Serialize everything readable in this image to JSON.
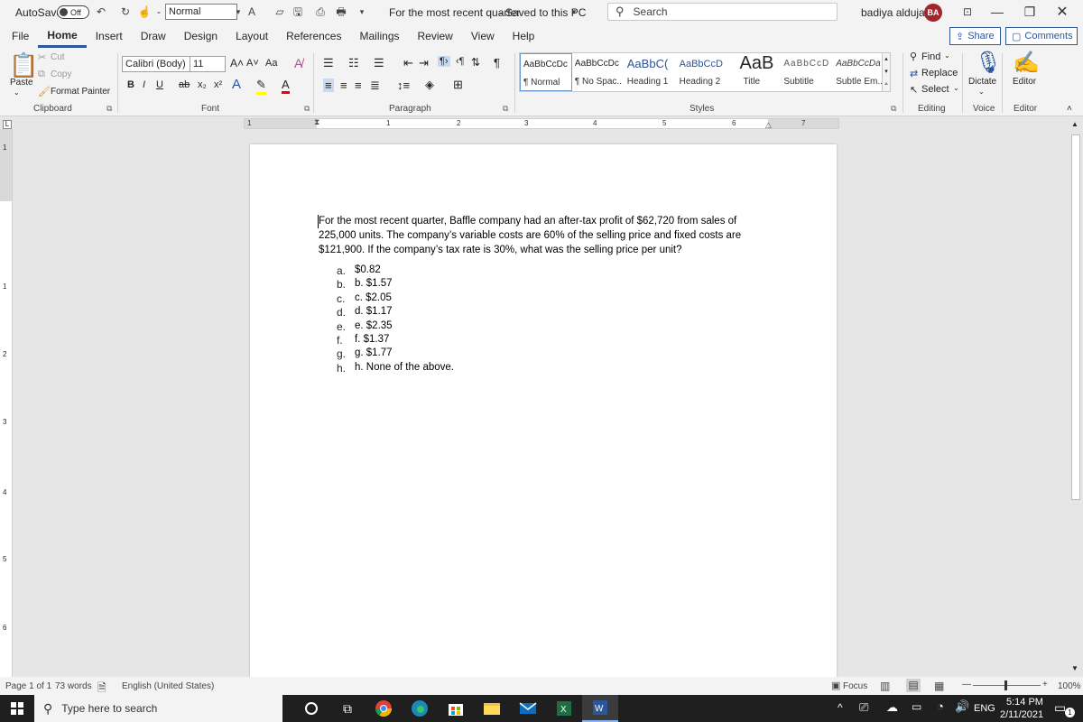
{
  "titlebar": {
    "autosave_label": "AutoSave",
    "autosave_state": "Off",
    "style_value": "Normal",
    "doc_title": "For the most recent quarter",
    "save_status": "Saved to this PC",
    "search_placeholder": "Search",
    "user_name": "badiya aldujaili",
    "user_initials": "BA"
  },
  "menu": {
    "items": [
      "File",
      "Home",
      "Insert",
      "Draw",
      "Design",
      "Layout",
      "References",
      "Mailings",
      "Review",
      "View",
      "Help"
    ],
    "share_label": "Share",
    "comments_label": "Comments"
  },
  "ribbon": {
    "clipboard": {
      "paste": "Paste",
      "cut": "Cut",
      "copy": "Copy",
      "format_painter": "Format Painter",
      "label": "Clipboard"
    },
    "font": {
      "name": "Calibri (Body)",
      "size": "11",
      "label": "Font",
      "case": "Aa"
    },
    "paragraph": {
      "label": "Paragraph"
    },
    "styles": {
      "label": "Styles",
      "items": [
        {
          "sample": "AaBbCcDc",
          "name": "¶ Normal"
        },
        {
          "sample": "AaBbCcDc",
          "name": "¶ No Spac..."
        },
        {
          "sample": "AaBbC(",
          "name": "Heading 1"
        },
        {
          "sample": "AaBbCcD",
          "name": "Heading 2"
        },
        {
          "sample": "AaB",
          "name": "Title"
        },
        {
          "sample": "AaBbCcD",
          "name": "Subtitle"
        },
        {
          "sample": "AaBbCcDa",
          "name": "Subtle Em..."
        }
      ]
    },
    "editing": {
      "find": "Find",
      "replace": "Replace",
      "select": "Select",
      "label": "Editing"
    },
    "voice": {
      "dictate": "Dictate",
      "label": "Voice"
    },
    "editor": {
      "editor": "Editor",
      "label": "Editor"
    }
  },
  "ruler": {
    "numbers": [
      "1",
      "1",
      "2",
      "3",
      "4",
      "5",
      "6",
      "7"
    ]
  },
  "vruler": {
    "numbers": [
      "1",
      "1",
      "2",
      "3",
      "4",
      "5",
      "6"
    ]
  },
  "document": {
    "question": "For the most recent quarter, Baffle company had an after-tax profit of $62,720 from sales of 225,000 units. The company’s variable costs are 60% of the selling price and fixed costs are $121,900. If the company’s tax rate is 30%, what was the selling price per unit?",
    "options": [
      {
        "letter": "a.",
        "text": "$0.82"
      },
      {
        "letter": "b.",
        "text": "b. $1.57"
      },
      {
        "letter": "c.",
        "text": "c. $2.05"
      },
      {
        "letter": "d.",
        "text": "d. $1.17"
      },
      {
        "letter": "e.",
        "text": "e. $2.35"
      },
      {
        "letter": "f.",
        "text": "f. $1.37"
      },
      {
        "letter": "g.",
        "text": "g. $1.77"
      },
      {
        "letter": "h.",
        "text": "h. None of the above."
      }
    ]
  },
  "status": {
    "page": "Page 1 of 1",
    "words": "73 words",
    "language": "English (United States)",
    "focus": "Focus",
    "zoom": "100%"
  },
  "taskbar": {
    "search_placeholder": "Type here to search",
    "lang": "ENG",
    "time": "5:14 PM",
    "date": "2/11/2021",
    "notification_count": "1"
  },
  "colors": {
    "accent": "#2b579a",
    "avatar": "#a4262c",
    "taskbar": "#1f1f1f"
  }
}
